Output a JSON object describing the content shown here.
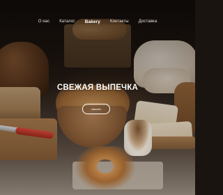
{
  "nav": {
    "items": [
      {
        "label": "О нас"
      },
      {
        "label": "Каталог"
      },
      {
        "label": "Bakery"
      },
      {
        "label": "Контакты"
      },
      {
        "label": "Доставка"
      }
    ]
  },
  "hero": {
    "title": "СВЕЖАЯ ВЫПЕЧКА",
    "cta_label": "заказать"
  }
}
